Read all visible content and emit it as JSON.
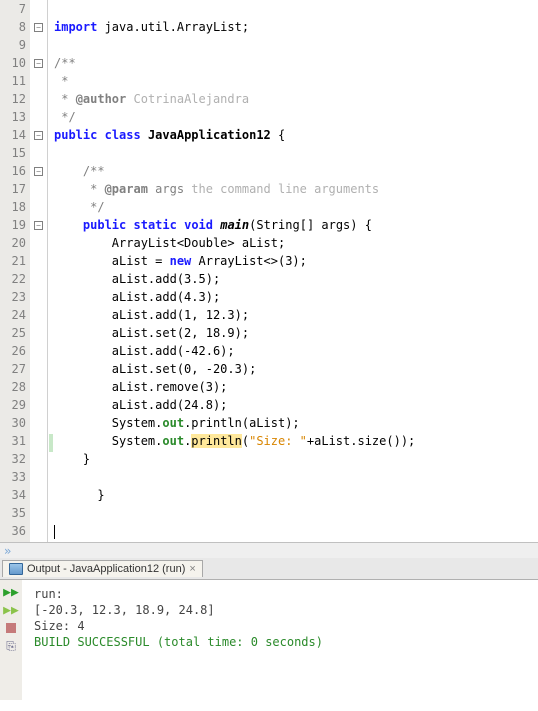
{
  "gutter": {
    "start": 7,
    "end": 36
  },
  "code": {
    "l8": {
      "import": "import",
      "pkg": " java.util.ArrayList;"
    },
    "l10": "/**",
    "l11": " *",
    "l12": {
      "pre": " * ",
      "tag": "@author",
      "name": " CotrinaAlejandra"
    },
    "l13": " */",
    "l14": {
      "pub": "public",
      "sp1": " ",
      "cls": "class",
      "sp2": " ",
      "name": "JavaApplication12",
      "tail": " {"
    },
    "l16": "    /**",
    "l17": {
      "pre": "     * ",
      "tag": "@param",
      "arg": " args",
      "desc": " the command line arguments"
    },
    "l18": "     */",
    "l19": {
      "ind": "    ",
      "pub": "public",
      "sp1": " ",
      "stat": "static",
      "sp2": " ",
      "vd": "void",
      "sp3": " ",
      "mname": "main",
      "args": "(String[] args) {"
    },
    "l20": "        ArrayList<Double> aList;",
    "l21": {
      "ind": "        aList = ",
      "nw": "new",
      "tail": " ArrayList<>(3);"
    },
    "l22": "        aList.add(3.5);",
    "l23": "        aList.add(4.3);",
    "l24": "        aList.add(1, 12.3);",
    "l25": "        aList.set(2, 18.9);",
    "l26": "        aList.add(-42.6);",
    "l27": "        aList.set(0, -20.3);",
    "l28": "        aList.remove(3);",
    "l29": "        aList.add(24.8);",
    "l30": {
      "ind": "        System.",
      "out": "out",
      "dot": ".println(aList);"
    },
    "l31": {
      "ind": "        System.",
      "out": "out",
      "dot": ".",
      "pl": "println",
      "op": "(",
      "str": "\"Size: \"",
      "tail": "+aList.size());"
    },
    "l32": "    }",
    "l34": "      }"
  },
  "output": {
    "tab": "Output - JavaApplication12 (run)",
    "lines": {
      "run": "run:",
      "arr": "[-20.3, 12.3, 18.9, 24.8]",
      "size": "Size: 4",
      "build": "BUILD SUCCESSFUL (total time: 0 seconds)"
    }
  },
  "chart_data": null
}
